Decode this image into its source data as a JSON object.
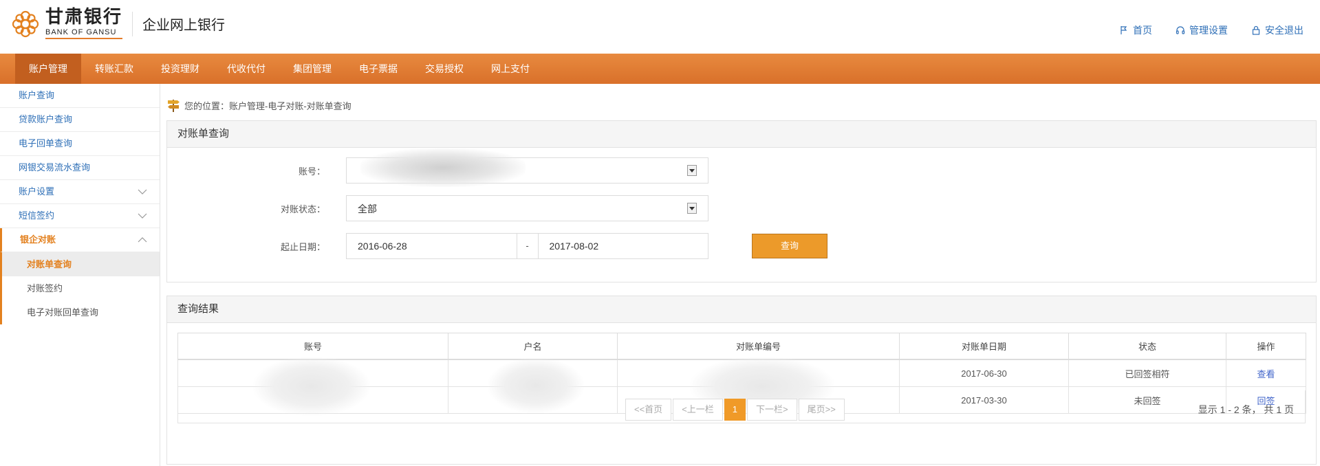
{
  "brand": {
    "name_cn": "甘肃银行",
    "name_en": "BANK OF GANSU",
    "product": "企业网上银行",
    "accent": "#e3811f",
    "nav_bg": "#e07a31"
  },
  "header_links": [
    {
      "label": "首页",
      "icon": "flag-icon"
    },
    {
      "label": "管理设置",
      "icon": "headset-icon"
    },
    {
      "label": "安全退出",
      "icon": "lock-icon"
    }
  ],
  "nav": [
    {
      "label": "账户管理",
      "active": true
    },
    {
      "label": "转账汇款"
    },
    {
      "label": "投资理财"
    },
    {
      "label": "代收代付"
    },
    {
      "label": "集团管理"
    },
    {
      "label": "电子票据"
    },
    {
      "label": "交易授权"
    },
    {
      "label": "网上支付"
    }
  ],
  "sidebar": {
    "items": [
      {
        "label": "账户查询"
      },
      {
        "label": "贷款账户查询"
      },
      {
        "label": "电子回单查询"
      },
      {
        "label": "网银交易流水查询"
      },
      {
        "label": "账户设置"
      },
      {
        "label": "短信签约"
      },
      {
        "label": "银企对账"
      }
    ],
    "sub_items": [
      {
        "label": "对账单查询",
        "active": true
      },
      {
        "label": "对账签约"
      },
      {
        "label": "电子对账回单查询"
      }
    ]
  },
  "breadcrumb": "您的位置：账户管理-电子对账-对账单查询",
  "query_panel": {
    "title": "对账单查询",
    "account_label": "账号：",
    "account_value": "",
    "status_label": "对账状态：",
    "status_value": "全部",
    "date_label": "起止日期：",
    "date_from": "2016-06-28",
    "date_sep": "-",
    "date_to": "2017-08-02",
    "query_button": "查询"
  },
  "result_panel": {
    "title": "查询结果",
    "columns": [
      "账号",
      "户名",
      "对账单编号",
      "对账单日期",
      "状态",
      "操作"
    ],
    "rows": [
      {
        "account": "",
        "name": "",
        "number": "",
        "date": "2017-06-30",
        "status": "已回签相符",
        "action": "查看"
      },
      {
        "account": "",
        "name": "",
        "number": "",
        "date": "2017-03-30",
        "status": "未回签",
        "action": "回签"
      }
    ],
    "pager": {
      "first": "<<首页",
      "prev": "<上一栏",
      "current": "1",
      "next": "下一栏>",
      "last": "尾页>>"
    },
    "summary": "显示 1 - 2 条， 共 1 页"
  }
}
